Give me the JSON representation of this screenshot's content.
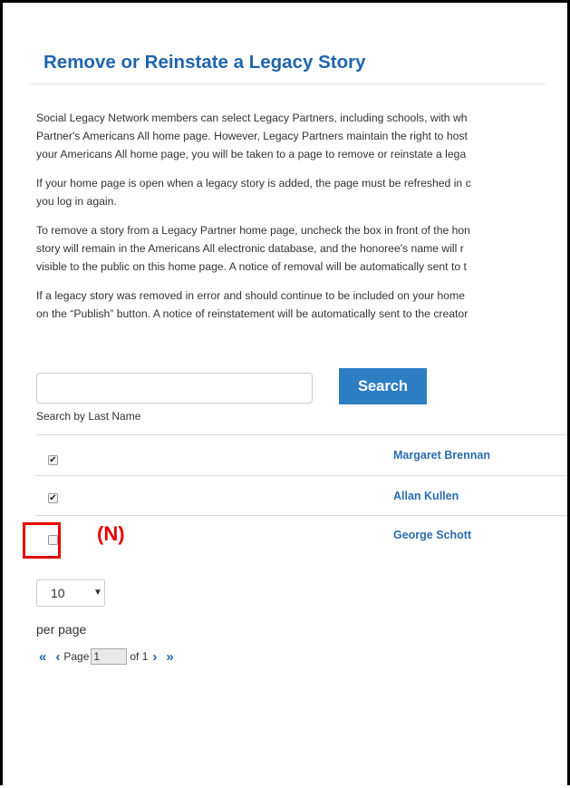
{
  "page": {
    "title": "Remove or Reinstate a Legacy Story",
    "paragraphs": [
      [
        "Social Legacy Network members can select Legacy Partners, including schools, with wh",
        "Partner's Americans All home page. However, Legacy Partners maintain the right to host",
        "your Americans All home page, you will be taken to a page to remove or reinstate a lega"
      ],
      [
        "If your home page is open when a legacy story is added, the page must be refreshed in c",
        "you log in again."
      ],
      [
        "To remove a story from a Legacy Partner home page, uncheck the box in front of the hon",
        "story will remain in the Americans All electronic database, and the honoree's name will r",
        "visible to the public on this home page. A notice of removal will be automatically sent to t"
      ],
      [
        "If a legacy story was removed in error and should continue to be included on your home",
        "on the “Publish” button. A notice of reinstatement will be automatically sent to the creator"
      ]
    ]
  },
  "search": {
    "input_value": "",
    "button_label": "Search",
    "caption": "Search by Last Name"
  },
  "stories": [
    {
      "name": "Margaret Brennan",
      "checked": true
    },
    {
      "name": "Allan Kullen",
      "checked": true
    },
    {
      "name": "George Schott",
      "checked": false
    }
  ],
  "annotation": {
    "label": "(N)",
    "color": "#e60000"
  },
  "pagination": {
    "per_page_value": "10",
    "per_page_caption": "per page",
    "first": "«",
    "prev": "‹",
    "page_label": "Page",
    "page_value": "1",
    "of_label": "of 1",
    "next": "›",
    "last": "»"
  },
  "colors": {
    "link": "#2b6cae",
    "button": "#2e7ec4",
    "title": "#1f65ae"
  }
}
